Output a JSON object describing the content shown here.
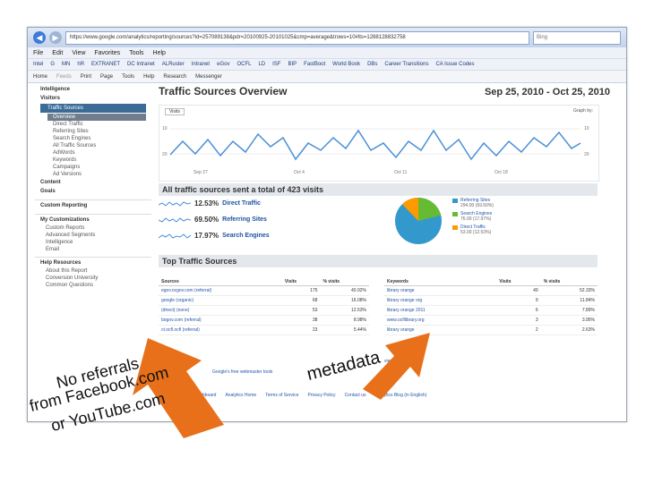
{
  "browser": {
    "address": "https://www.google.com/analytics/reporting/sources?id=257089138&pdr=20100925-20101025&cmp=average&trows=10#lts=1288128832758",
    "search_placeholder": "Bing",
    "menu": [
      "File",
      "Edit",
      "View",
      "Favorites",
      "Tools",
      "Help"
    ],
    "links": [
      "Intel",
      "G",
      "MN",
      "hR",
      "EXTRANET",
      "DC Intranet",
      "ALRuster",
      "Intranet",
      "eGov",
      "OCFL",
      "LD",
      "ISF",
      "BIP",
      "FastBoot",
      "World Book",
      "DBs",
      "Career Transitions",
      "CA Issue Codes"
    ],
    "tools": [
      "Home",
      "Feeds",
      "Print",
      "Page",
      "Tools",
      "Help",
      "Research",
      "Messenger"
    ]
  },
  "sidebar": {
    "intelligence": "Intelligence",
    "visitors": "Visitors",
    "traffic_sources": "Traffic Sources",
    "items": [
      "Overview",
      "Direct Traffic",
      "Referring Sites",
      "Search Engines",
      "All Traffic Sources",
      "AdWords",
      "Keywords",
      "Campaigns",
      "Ad Versions"
    ],
    "content": "Content",
    "goals": "Goals",
    "custom_reporting": "Custom Reporting",
    "my_customizations": "My Customizations",
    "custom_items": [
      "Custom Reports",
      "Advanced Segments",
      "Intelligence",
      "Email"
    ],
    "help_resources": "Help Resources",
    "help_items": [
      "About this Report",
      "Conversion University",
      "Common Questions"
    ]
  },
  "main": {
    "title": "Traffic Sources Overview",
    "date_range": "Sep 25, 2010 - Oct 25, 2010",
    "graph_selector": "Visits",
    "graph_by": "Graph by:",
    "graph_ylabels": [
      "10",
      "20",
      "10",
      "20"
    ],
    "graph_xlabels": [
      "Sep 27",
      "Oct 4",
      "Oct 11",
      "Oct 18"
    ],
    "summary_banner": "All traffic sources sent a total of 423 visits",
    "summary": [
      {
        "pct": "12.53%",
        "label": "Direct Traffic"
      },
      {
        "pct": "69.50%",
        "label": "Referring Sites"
      },
      {
        "pct": "17.97%",
        "label": "Search Engines"
      }
    ],
    "legend": [
      {
        "label": "Referring Sites",
        "sub": "294.00 (69.50%)",
        "color": "#3399cc"
      },
      {
        "label": "Search Engines",
        "sub": "76.00 (17.97%)",
        "color": "#66bb33"
      },
      {
        "label": "Direct Traffic",
        "sub": "53.00 (12.53%)",
        "color": "#ff9900"
      }
    ],
    "top_banner": "Top Traffic Sources",
    "sources_headers": [
      "Sources",
      "Visits",
      "% visits"
    ],
    "sources_rows": [
      [
        "egov.ocgov.com (referral)",
        "175",
        "40.92%"
      ],
      [
        "google (organic)",
        "68",
        "16.08%"
      ],
      [
        "(direct) (none)",
        "53",
        "12.53%"
      ],
      [
        "bogov.com (referral)",
        "38",
        "8.98%"
      ],
      [
        "ct.ocfl.ocfl (referral)",
        "23",
        "5.44%"
      ]
    ],
    "keywords_headers": [
      "Keywords",
      "Visits",
      "% visits"
    ],
    "keywords_rows": [
      [
        "library orange",
        "49",
        "52.33%"
      ],
      [
        "library orange org",
        "9",
        "11.84%"
      ],
      [
        "library orange 2011",
        "6",
        "7.89%"
      ],
      [
        "www.ocfllibrary.org",
        "3",
        "3.95%"
      ],
      [
        "library orange",
        "2",
        "2.63%"
      ]
    ],
    "view_report": "view full report",
    "footer": "Google's free webmaster tools",
    "footer_links": [
      "Dashboard",
      "Analytics Home",
      "Terms of Service",
      "Privacy Policy",
      "Contact us",
      "Analytics Blog (in English)"
    ]
  },
  "annotations": {
    "left_lines": [
      "No referrals",
      "from Facebook.com",
      "or YouTube.com"
    ],
    "right": "metadata"
  },
  "colors": {
    "arrow": "#e8701a",
    "line": "#4a8fd6",
    "banner": "#e4e8ec",
    "active": "#3b6b96"
  }
}
